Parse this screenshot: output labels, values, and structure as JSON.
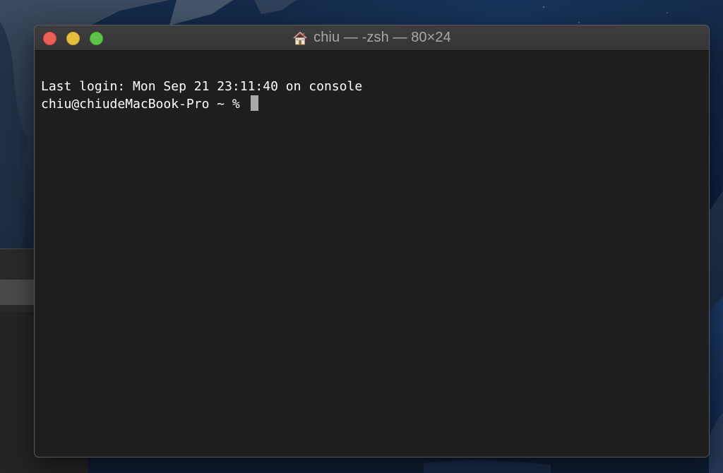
{
  "window": {
    "title": "chiu — -zsh — 80×24",
    "title_icon": "home-icon"
  },
  "titlebar": {
    "buttons": [
      "close",
      "minimize",
      "zoom"
    ],
    "colors": {
      "close": "#ec5f57",
      "minimize": "#e6be3c",
      "zoom": "#5fc34a"
    }
  },
  "terminal": {
    "last_login": "Last login: Mon Sep 21 23:11:40 on console",
    "prompt": "chiu@chiudeMacBook-Pro ~ % ",
    "background_color": "#1e1e1e",
    "text_color": "#ffffff",
    "cursor_color": "#a9a9a9"
  }
}
